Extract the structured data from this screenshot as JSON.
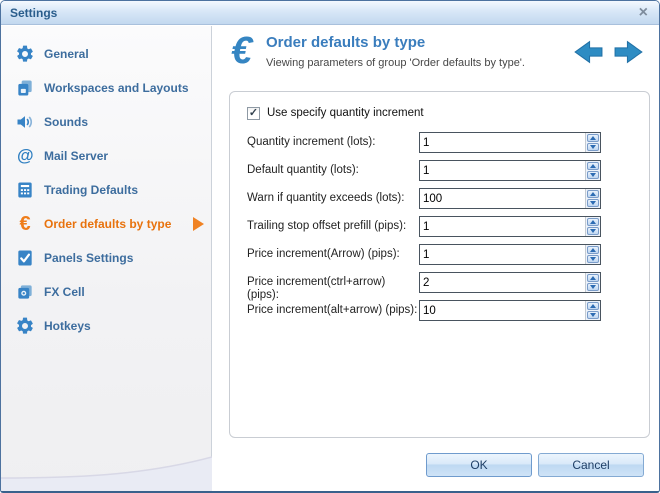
{
  "window": {
    "title": "Settings"
  },
  "icons": {
    "close": "×",
    "check": "✓",
    "euro": "€",
    "at": "@"
  },
  "colors": {
    "accent_blue": "#3884c6",
    "selected_orange": "#e8720d",
    "title_blue": "#3a7dbd"
  },
  "sidebar": {
    "items": [
      {
        "label": "General"
      },
      {
        "label": "Workspaces and Layouts"
      },
      {
        "label": "Sounds"
      },
      {
        "label": "Mail Server"
      },
      {
        "label": "Trading Defaults"
      },
      {
        "label": "Order defaults by type",
        "selected": true
      },
      {
        "label": "Panels Settings"
      },
      {
        "label": "FX Cell"
      },
      {
        "label": "Hotkeys"
      }
    ]
  },
  "header": {
    "title": "Order defaults by type",
    "subtitle": "Viewing parameters of group 'Order defaults by type'."
  },
  "form": {
    "checkbox_label": "Use specify quantity increment",
    "checkbox_checked": true,
    "fields": [
      {
        "label": "Quantity increment (lots):",
        "value": "1"
      },
      {
        "label": "Default quantity (lots):",
        "value": "1"
      },
      {
        "label": "Warn if quantity exceeds (lots):",
        "value": "100"
      },
      {
        "label": "Trailing stop offset prefill (pips):",
        "value": "1"
      },
      {
        "label": "Price increment(Arrow) (pips):",
        "value": "1"
      },
      {
        "label": "Price increment(ctrl+arrow) (pips):",
        "value": "2"
      },
      {
        "label": "Price increment(alt+arrow) (pips):",
        "value": "10"
      }
    ]
  },
  "footer": {
    "ok": "OK",
    "cancel": "Cancel"
  }
}
